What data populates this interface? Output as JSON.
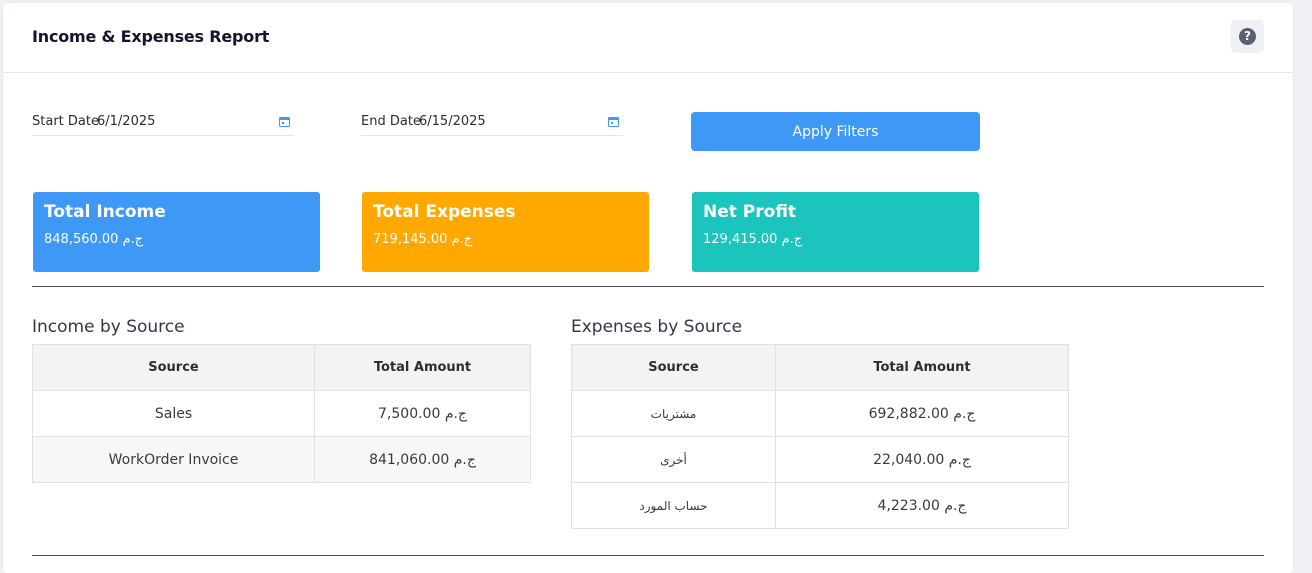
{
  "report": {
    "title": "Income & Expenses Report"
  },
  "filters": {
    "start_label": "Start Date",
    "start_value": "6/1/2025",
    "end_label": "End Date",
    "end_value": "6/15/2025",
    "apply_label": "Apply Filters"
  },
  "summary": {
    "income": {
      "label": "Total Income",
      "value": "848,560.00 ج.م",
      "color": "#3d99f5"
    },
    "expenses": {
      "label": "Total Expenses",
      "value": "719,145.00 ج.م",
      "color": "#ffa800"
    },
    "profit": {
      "label": "Net Profit",
      "value": "129,415.00 ج.م",
      "color": "#1bc5bd"
    }
  },
  "income_table": {
    "title": "Income by Source",
    "headers": [
      "Source",
      "Total Amount"
    ],
    "rows": [
      {
        "source": "Sales",
        "amount": "7,500.00 ج.م"
      },
      {
        "source": "WorkOrder Invoice",
        "amount": "841,060.00 ج.م"
      }
    ]
  },
  "expenses_table": {
    "title": "Expenses by Source",
    "headers": [
      "Source",
      "Total Amount"
    ],
    "rows": [
      {
        "source": "مشتريات",
        "amount": "692,882.00 ج.م"
      },
      {
        "source": "أخرى",
        "amount": "22,040.00 ج.م"
      },
      {
        "source": "حساب المورد",
        "amount": "4,223.00 ج.م"
      }
    ]
  },
  "icons": {
    "help": "question-circle-icon",
    "calendar": "calendar-icon"
  }
}
